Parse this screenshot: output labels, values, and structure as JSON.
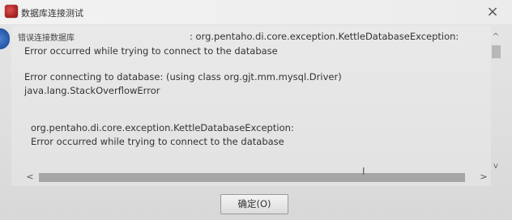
{
  "window": {
    "title": "数据库连接测试",
    "close_glyph": "×"
  },
  "message": {
    "heading_label": "错误连接数据库",
    "line1": ": org.pentaho.di.core.exception.KettleDatabaseException:",
    "line2": "Error occurred while trying to connect to the database",
    "line3": "Error connecting to database: (using class org.gjt.mm.mysql.Driver)",
    "line4": "java.lang.StackOverflowError",
    "line5": "org.pentaho.di.core.exception.KettleDatabaseException:",
    "line6": "Error occurred while trying to connect to the database"
  },
  "scrollbars": {
    "up_glyph": "^",
    "down_glyph": "v",
    "left_glyph": "<",
    "right_glyph": ">"
  },
  "buttons": {
    "ok_label": "确定(O)"
  },
  "icons": {
    "app": "database-icon",
    "error": "error-icon"
  }
}
